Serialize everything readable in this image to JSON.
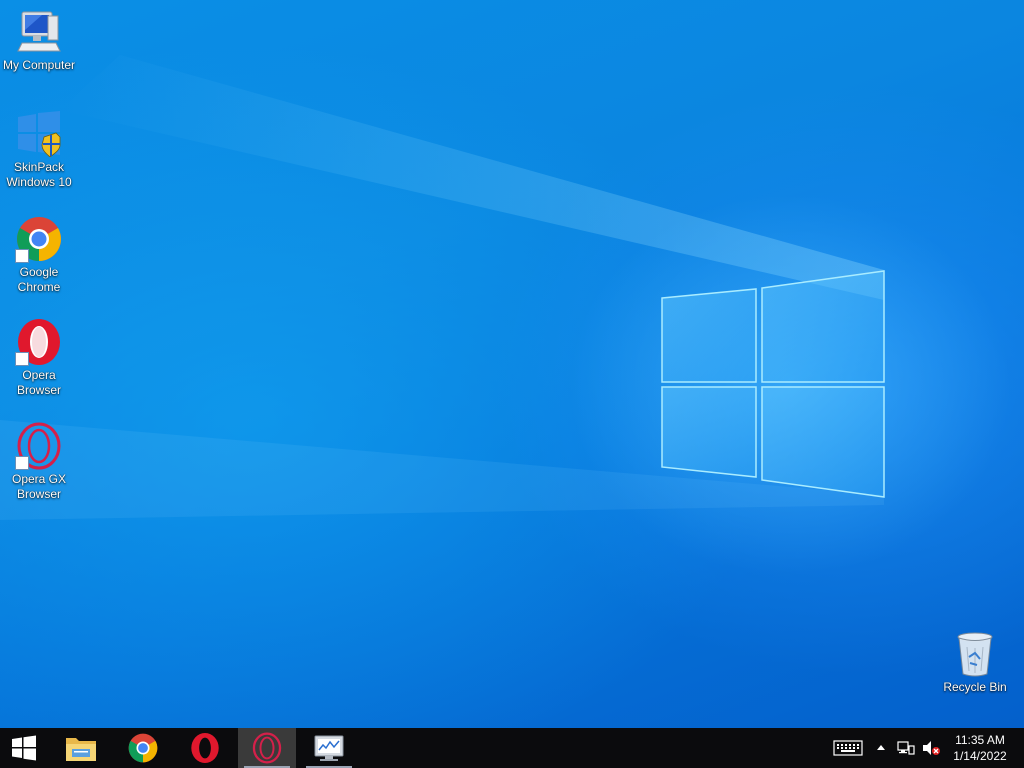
{
  "desktop": {
    "icons": [
      {
        "name": "My Computer",
        "icon": "computer-icon"
      },
      {
        "name": "SkinPack\nWindows 10",
        "icon": "windows-shield-icon"
      },
      {
        "name": "Google\nChrome",
        "icon": "chrome-icon"
      },
      {
        "name": "Opera\nBrowser",
        "icon": "opera-icon"
      },
      {
        "name": "Opera GX\nBrowser",
        "icon": "opera-gx-icon"
      }
    ],
    "recycle_bin": {
      "name": "Recycle Bin",
      "icon": "recycle-bin-icon"
    }
  },
  "taskbar": {
    "start_icon": "windows-logo-icon",
    "pinned": [
      {
        "app": "File Explorer",
        "icon": "folder-icon",
        "state": "idle"
      },
      {
        "app": "Google Chrome",
        "icon": "chrome-icon",
        "state": "idle"
      },
      {
        "app": "Opera Browser",
        "icon": "opera-icon",
        "state": "idle"
      },
      {
        "app": "Opera GX Browser",
        "icon": "opera-gx-icon",
        "state": "active"
      },
      {
        "app": "Performance Monitor",
        "icon": "monitor-chart-icon",
        "state": "running"
      }
    ],
    "tray": {
      "keyboard_icon": "keyboard-icon",
      "overflow_icon": "chevron-up-icon",
      "network_icon": "network-icon",
      "volume_icon": "volume-muted-icon"
    },
    "clock": {
      "time": "11:35 AM",
      "date": "1/14/2022"
    }
  },
  "colors": {
    "wallpaper_blue": "#0b86e0",
    "taskbar": "#0b0b0d",
    "opera_red": "#e0182d",
    "opera_gx_red": "#d4204a"
  }
}
